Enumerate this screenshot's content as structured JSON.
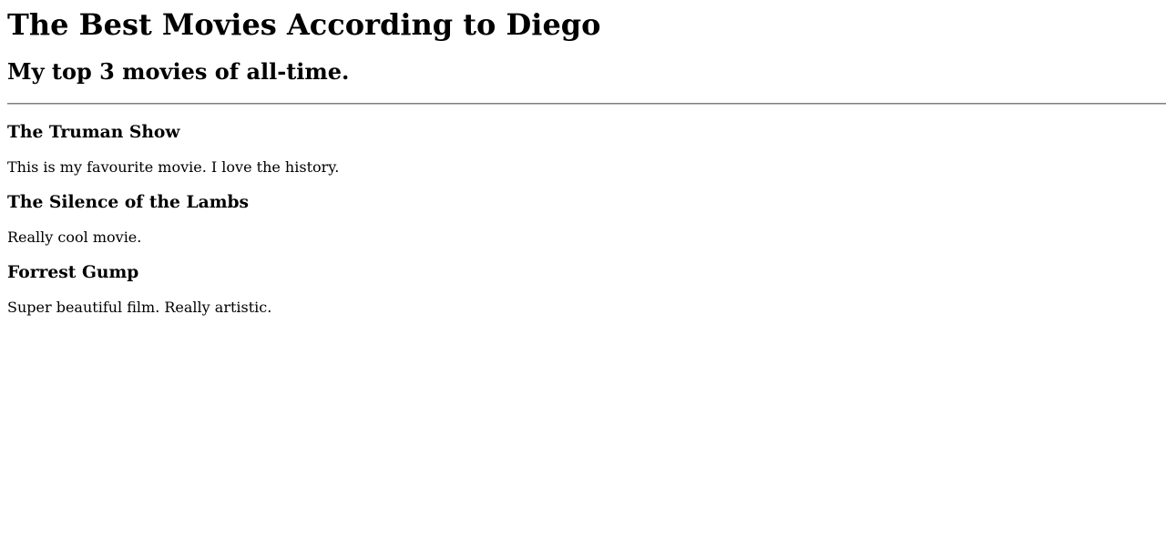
{
  "page": {
    "title": "The Best Movies According to Diego",
    "subtitle": "My top 3 movies of all-time."
  },
  "movies": [
    {
      "title": "The Truman Show",
      "description": "This is my favourite movie. I love the history."
    },
    {
      "title": "The Silence of the Lambs",
      "description": "Really cool movie."
    },
    {
      "title": "Forrest Gump",
      "description": "Super beautiful film. Really artistic."
    }
  ]
}
